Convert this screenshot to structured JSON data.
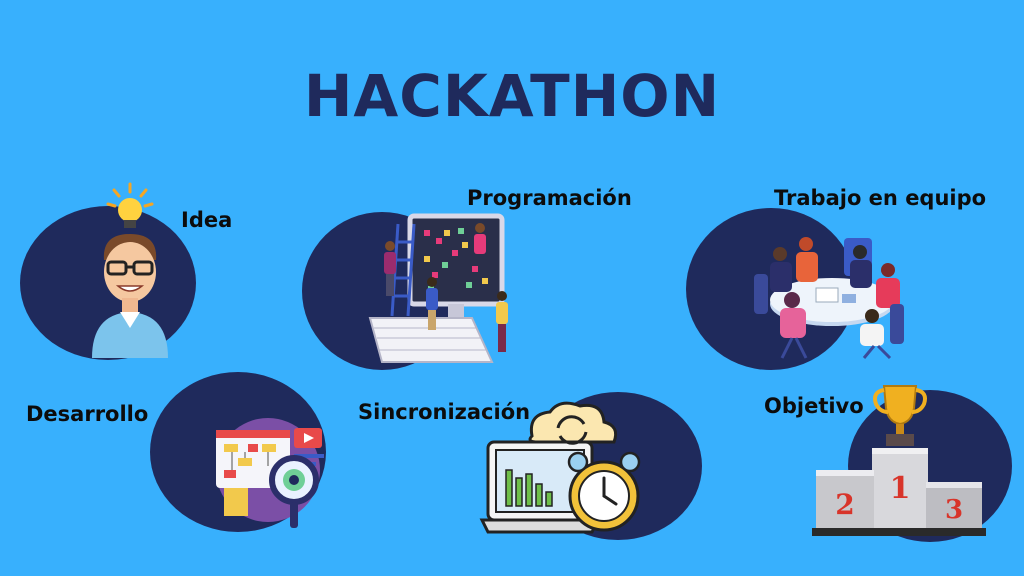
{
  "title": "HACKATHON",
  "items": [
    {
      "label": "Idea",
      "icon": "idea-person-icon"
    },
    {
      "label": "Programación",
      "icon": "programming-screen-icon"
    },
    {
      "label": "Trabajo en equipo",
      "icon": "team-meeting-icon"
    },
    {
      "label": "Desarrollo",
      "icon": "development-dashboard-icon"
    },
    {
      "label": "Sincronización",
      "icon": "sync-cloud-clock-icon"
    },
    {
      "label": "Objetivo",
      "icon": "podium-trophy-icon"
    }
  ],
  "podium": {
    "first": "1",
    "second": "2",
    "third": "3"
  },
  "colors": {
    "background": "#38b0fd",
    "circle": "#1f2a5c",
    "title": "#1f2a5c",
    "label": "#0c0c0c"
  }
}
